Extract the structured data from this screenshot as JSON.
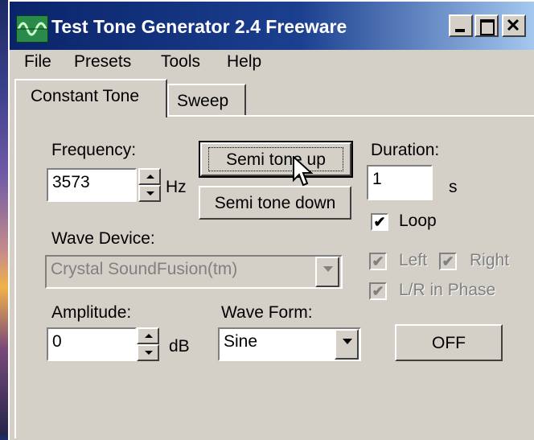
{
  "window": {
    "title": "Test Tone Generator 2.4 Freeware",
    "app_icon": "waveform-icon"
  },
  "menu": [
    "File",
    "Presets",
    "Tools",
    "Help"
  ],
  "tabs": [
    {
      "label": "Constant Tone",
      "selected": true
    },
    {
      "label": "Sweep",
      "selected": false
    }
  ],
  "frequency": {
    "label": "Frequency:",
    "value": "3573",
    "unit": "Hz"
  },
  "buttons": {
    "semitone_up": "Semi tone up",
    "semitone_down": "Semi tone down",
    "off": "OFF"
  },
  "duration": {
    "label": "Duration:",
    "value": "1",
    "unit": "s"
  },
  "loop": {
    "label": "Loop",
    "checked": true
  },
  "wave_device": {
    "label": "Wave Device:",
    "value": "Crystal SoundFusion(tm)",
    "enabled": false
  },
  "channels": {
    "left": "Left",
    "right": "Right",
    "lr_phase": "L/R in Phase",
    "enabled": false
  },
  "amplitude": {
    "label": "Amplitude:",
    "value": "0",
    "unit": "dB"
  },
  "wave_form": {
    "label": "Wave Form:",
    "value": "Sine"
  },
  "colors": {
    "titlebar": "#0a246a",
    "face": "#d4d0c8"
  }
}
